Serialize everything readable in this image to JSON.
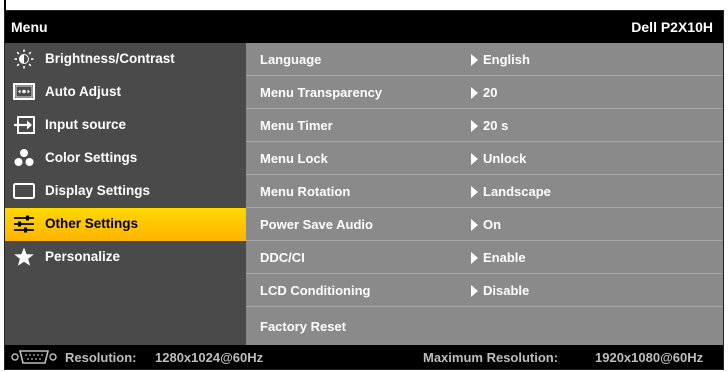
{
  "header": {
    "title": "Menu",
    "model": "Dell P2X10H"
  },
  "sidebar": {
    "items": [
      {
        "label": "Brightness/Contrast",
        "icon": "brightness-icon"
      },
      {
        "label": "Auto Adjust",
        "icon": "auto-adjust-icon"
      },
      {
        "label": "Input source",
        "icon": "input-source-icon"
      },
      {
        "label": "Color Settings",
        "icon": "color-settings-icon"
      },
      {
        "label": "Display Settings",
        "icon": "display-settings-icon"
      },
      {
        "label": "Other Settings",
        "icon": "other-settings-icon",
        "selected": true
      },
      {
        "label": "Personalize",
        "icon": "star-icon"
      }
    ]
  },
  "settings": {
    "rows": [
      {
        "name": "Language",
        "value": "English"
      },
      {
        "name": "Menu Transparency",
        "value": "20"
      },
      {
        "name": "Menu Timer",
        "value": "20 s"
      },
      {
        "name": "Menu Lock",
        "value": "Unlock"
      },
      {
        "name": "Menu Rotation",
        "value": "Landscape"
      },
      {
        "name": "Power Save Audio",
        "value": "On"
      },
      {
        "name": "DDC/CI",
        "value": "Enable"
      },
      {
        "name": "LCD Conditioning",
        "value": "Disable"
      },
      {
        "name": "Factory Reset",
        "value": ""
      }
    ]
  },
  "footer": {
    "resolution_label": "Resolution:",
    "resolution_value": "1280x1024@60Hz",
    "max_label": "Maximum Resolution:",
    "max_value": "1920x1080@60Hz",
    "connector_icon": "vga-connector-icon"
  },
  "colors": {
    "selected": "#ffc800",
    "sidebar_bg": "#4a4a4a",
    "content_bg": "#8a8a8a",
    "title_bg": "#000000"
  }
}
